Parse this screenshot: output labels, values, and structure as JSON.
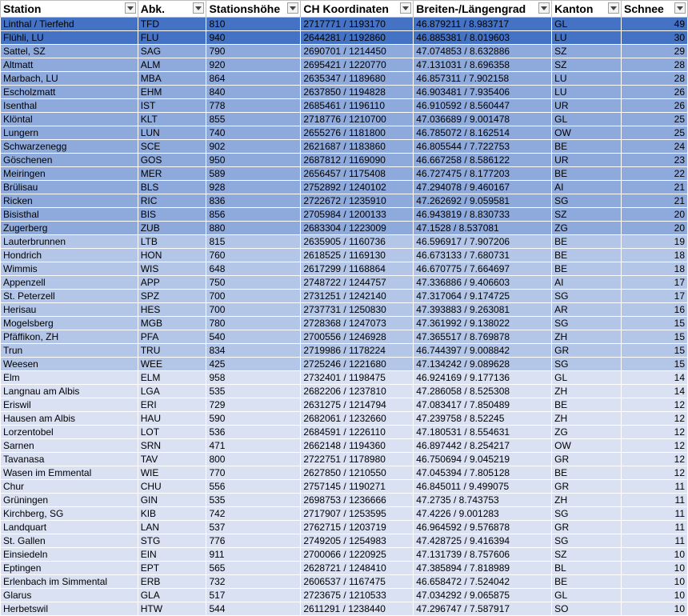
{
  "headers": [
    "Station",
    "Abk.",
    "Stationshöhe",
    "CH Koordinaten",
    "Breiten-/Längengrad",
    "Kanton",
    "Schnee"
  ],
  "filter_icon": "dropdown-filter-icon",
  "colors": {
    "selected": "#4472c4",
    "band1": "#8ea9db",
    "band2": "#b4c6e7",
    "band3": "#d9e1f2"
  },
  "rows": [
    [
      "Linthal / Tierfehd",
      "TFD",
      "810",
      "2717771 / 1193170",
      "46.879211 / 8.983717",
      "GL",
      "49"
    ],
    [
      "Flühli, LU",
      "FLU",
      "940",
      "2644281 / 1192860",
      "46.885381 / 8.019603",
      "LU",
      "30"
    ],
    [
      "Sattel, SZ",
      "SAG",
      "790",
      "2690701 / 1214450",
      "47.074853 / 8.632886",
      "SZ",
      "29"
    ],
    [
      "Altmatt",
      "ALM",
      "920",
      "2695421 / 1220770",
      "47.131031 / 8.696358",
      "SZ",
      "28"
    ],
    [
      "Marbach, LU",
      "MBA",
      "864",
      "2635347 / 1189680",
      "46.857311 / 7.902158",
      "LU",
      "28"
    ],
    [
      "Escholzmatt",
      "EHM",
      "840",
      "2637850 / 1194828",
      "46.903481 / 7.935406",
      "LU",
      "26"
    ],
    [
      "Isenthal",
      "IST",
      "778",
      "2685461 / 1196110",
      "46.910592 / 8.560447",
      "UR",
      "26"
    ],
    [
      "Klöntal",
      "KLT",
      "855",
      "2718776 / 1210700",
      "47.036689 / 9.001478",
      "GL",
      "25"
    ],
    [
      "Lungern",
      "LUN",
      "740",
      "2655276 / 1181800",
      "46.785072 / 8.162514",
      "OW",
      "25"
    ],
    [
      "Schwarzenegg",
      "SCE",
      "902",
      "2621687 / 1183860",
      "46.805544 / 7.722753",
      "BE",
      "24"
    ],
    [
      "Göschenen",
      "GOS",
      "950",
      "2687812 / 1169090",
      "46.667258 / 8.586122",
      "UR",
      "23"
    ],
    [
      "Meiringen",
      "MER",
      "589",
      "2656457 / 1175408",
      "46.727475 / 8.177203",
      "BE",
      "22"
    ],
    [
      "Brülisau",
      "BLS",
      "928",
      "2752892 / 1240102",
      "47.294078 / 9.460167",
      "AI",
      "21"
    ],
    [
      "Ricken",
      "RIC",
      "836",
      "2722672 / 1235910",
      "47.262692 / 9.059581",
      "SG",
      "21"
    ],
    [
      "Bisisthal",
      "BIS",
      "856",
      "2705984 / 1200133",
      "46.943819 / 8.830733",
      "SZ",
      "20"
    ],
    [
      "Zugerberg",
      "ZUB",
      "880",
      "2683304 / 1223009",
      "47.1528 / 8.537081",
      "ZG",
      "20"
    ],
    [
      "Lauterbrunnen",
      "LTB",
      "815",
      "2635905 / 1160736",
      "46.596917 / 7.907206",
      "BE",
      "19"
    ],
    [
      "Hondrich",
      "HON",
      "760",
      "2618525 / 1169130",
      "46.673133 / 7.680731",
      "BE",
      "18"
    ],
    [
      "Wimmis",
      "WIS",
      "648",
      "2617299 / 1168864",
      "46.670775 / 7.664697",
      "BE",
      "18"
    ],
    [
      "Appenzell",
      "APP",
      "750",
      "2748722 / 1244757",
      "47.336886 / 9.406603",
      "AI",
      "17"
    ],
    [
      "St. Peterzell",
      "SPZ",
      "700",
      "2731251 / 1242140",
      "47.317064 / 9.174725",
      "SG",
      "17"
    ],
    [
      "Herisau",
      "HES",
      "700",
      "2737731 / 1250830",
      "47.393883 / 9.263081",
      "AR",
      "16"
    ],
    [
      "Mogelsberg",
      "MGB",
      "780",
      "2728368 / 1247073",
      "47.361992 / 9.138022",
      "SG",
      "15"
    ],
    [
      "Pfäffikon, ZH",
      "PFA",
      "540",
      "2700556 / 1246928",
      "47.365517 / 8.769878",
      "ZH",
      "15"
    ],
    [
      "Trun",
      "TRU",
      "834",
      "2719986 / 1178224",
      "46.744397 / 9.008842",
      "GR",
      "15"
    ],
    [
      "Weesen",
      "WEE",
      "425",
      "2725246 / 1221680",
      "47.134242 / 9.089628",
      "SG",
      "15"
    ],
    [
      "Elm",
      "ELM",
      "958",
      "2732401 / 1198475",
      "46.924169 / 9.177136",
      "GL",
      "14"
    ],
    [
      "Langnau am Albis",
      "LGA",
      "535",
      "2682206 / 1237810",
      "47.286058 / 8.525308",
      "ZH",
      "14"
    ],
    [
      "Eriswil",
      "ERI",
      "729",
      "2631275 / 1214794",
      "47.083417 / 7.850489",
      "BE",
      "12"
    ],
    [
      "Hausen am Albis",
      "HAU",
      "590",
      "2682061 / 1232660",
      "47.239758 / 8.52245",
      "ZH",
      "12"
    ],
    [
      "Lorzentobel",
      "LOT",
      "536",
      "2684591 / 1226110",
      "47.180531 / 8.554631",
      "ZG",
      "12"
    ],
    [
      "Sarnen",
      "SRN",
      "471",
      "2662148 / 1194360",
      "46.897442 / 8.254217",
      "OW",
      "12"
    ],
    [
      "Tavanasa",
      "TAV",
      "800",
      "2722751 / 1178980",
      "46.750694 / 9.045219",
      "GR",
      "12"
    ],
    [
      "Wasen im Emmental",
      "WIE",
      "770",
      "2627850 / 1210550",
      "47.045394 / 7.805128",
      "BE",
      "12"
    ],
    [
      "Chur",
      "CHU",
      "556",
      "2757145 / 1190271",
      "46.845011 / 9.499075",
      "GR",
      "11"
    ],
    [
      "Grüningen",
      "GIN",
      "535",
      "2698753 / 1236666",
      "47.2735 / 8.743753",
      "ZH",
      "11"
    ],
    [
      "Kirchberg, SG",
      "KIB",
      "742",
      "2717907 / 1253595",
      "47.4226 / 9.001283",
      "SG",
      "11"
    ],
    [
      "Landquart",
      "LAN",
      "537",
      "2762715 / 1203719",
      "46.964592 / 9.576878",
      "GR",
      "11"
    ],
    [
      "St. Gallen",
      "STG",
      "776",
      "2749205 / 1254983",
      "47.428725 / 9.416394",
      "SG",
      "11"
    ],
    [
      "Einsiedeln",
      "EIN",
      "911",
      "2700066 / 1220925",
      "47.131739 / 8.757606",
      "SZ",
      "10"
    ],
    [
      "Eptingen",
      "EPT",
      "565",
      "2628721 / 1248410",
      "47.385894 / 7.818989",
      "BL",
      "10"
    ],
    [
      "Erlenbach im Simmental",
      "ERB",
      "732",
      "2606537 / 1167475",
      "46.658472 / 7.524042",
      "BE",
      "10"
    ],
    [
      "Glarus",
      "GLA",
      "517",
      "2723675 / 1210533",
      "47.034292 / 9.065875",
      "GL",
      "10"
    ],
    [
      "Herbetswil",
      "HTW",
      "544",
      "2611291 / 1238440",
      "47.296747 / 7.587917",
      "SO",
      "10"
    ]
  ]
}
